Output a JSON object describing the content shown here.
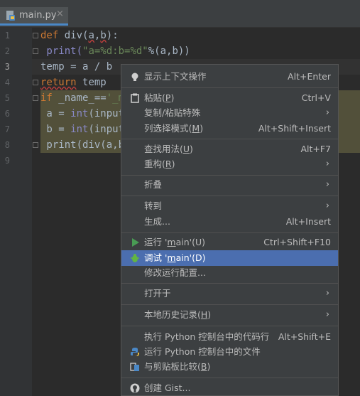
{
  "tab": {
    "filename": "main.py",
    "close": "×"
  },
  "editor": {
    "line_numbers": [
      "1",
      "2",
      "3",
      "4",
      "5",
      "6",
      "7",
      "8",
      "9"
    ],
    "lines": [
      [
        "def",
        " div(",
        "a",
        ",",
        "b",
        "):"
      ],
      [
        " print(",
        "\"a=%d:b=%d\"",
        "%(a,b))"
      ],
      [
        "temp = a / b"
      ],
      [
        "return",
        " ",
        "temp"
      ],
      [
        "if",
        " _name_==",
        "'_m"
      ],
      [
        " a = ",
        "int",
        "(input"
      ],
      [
        " b = ",
        "int",
        "(input"
      ],
      [
        " print(div(a,b"
      ]
    ]
  },
  "context_menu": {
    "items": [
      {
        "label": "显示上下文操作",
        "shortcut": "Alt+Enter",
        "icon": "lightbulb-icon"
      },
      {
        "label": "粘贴(",
        "mnemonic": "P",
        "label_end": ")",
        "shortcut": "Ctrl+V",
        "icon": "clipboard-icon"
      },
      {
        "label": "复制/粘贴特殊",
        "submenu": true
      },
      {
        "label": "列选择模式(",
        "mnemonic": "M",
        "label_end": ")",
        "shortcut": "Alt+Shift+Insert"
      },
      {
        "label": "查找用法(",
        "mnemonic": "U",
        "label_end": ")",
        "shortcut": "Alt+F7"
      },
      {
        "label": "重构(",
        "mnemonic": "R",
        "label_end": ")",
        "submenu": true
      },
      {
        "label": "折叠",
        "submenu": true
      },
      {
        "label": "转到",
        "submenu": true
      },
      {
        "label": "生成...",
        "shortcut": "Alt+Insert"
      },
      {
        "label": "运行 '",
        "mnemonic": "m",
        "label_end": "ain'(U)",
        "shortcut": "Ctrl+Shift+F10",
        "icon": "run-icon"
      },
      {
        "label": "调试 '",
        "mnemonic": "m",
        "label_end": "ain'(D)",
        "icon": "debug-icon",
        "selected": true
      },
      {
        "label": "修改运行配置..."
      },
      {
        "label": "打开于",
        "submenu": true
      },
      {
        "label": "本地历史记录(",
        "mnemonic": "H",
        "label_end": ")",
        "submenu": true
      },
      {
        "label": "执行 Python 控制台中的代码行",
        "shortcut": "Alt+Shift+E"
      },
      {
        "label": "运行 Python 控制台中的文件",
        "icon": "python-icon"
      },
      {
        "label": "与剪贴板比较(",
        "mnemonic": "B",
        "label_end": ")",
        "icon": "compare-icon"
      },
      {
        "label": "创建 Gist...",
        "icon": "github-icon"
      }
    ],
    "submenu_arrow": "›"
  },
  "colors": {
    "selection": "#4b6eaf",
    "keyword": "#cc7832",
    "string": "#6a8759",
    "builtin": "#8888c6"
  }
}
